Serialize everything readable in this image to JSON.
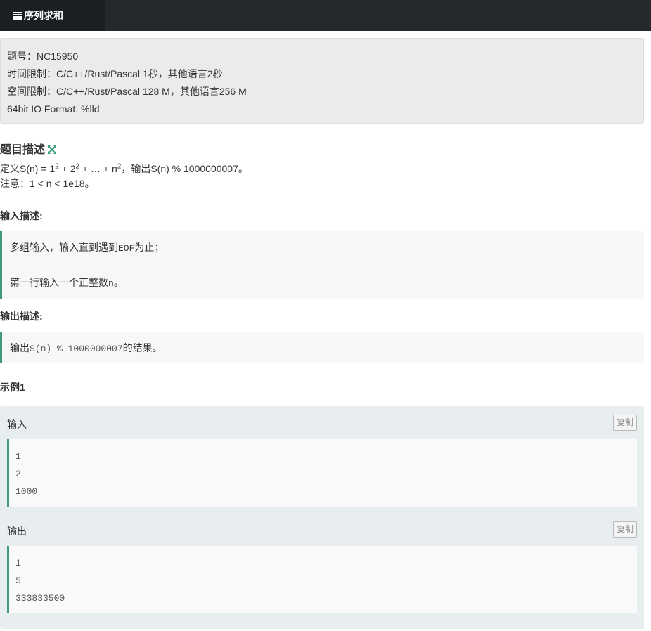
{
  "header": {
    "title": "序列求和",
    "icon": "list-icon"
  },
  "meta": {
    "problem_id": "题号：NC15950",
    "time_limit": "时间限制：C/C++/Rust/Pascal 1秒，其他语言2秒",
    "memory_limit": "空间限制：C/C++/Rust/Pascal 128 M，其他语言256 M",
    "io_format": "64bit IO Format: %lld"
  },
  "description": {
    "title": "题目描述",
    "expand_icon": "expand-icon",
    "def_prefix": "定义S(n) = 1",
    "exp": "2",
    "plus1": " + 2",
    "plus2": " + … + n",
    "def_suffix": "，输出S(n) % 1000000007。",
    "note": "注意：1 < n < 1e18。"
  },
  "input_desc": {
    "title": "输入描述:",
    "line1_text": "多组输入，输入直到遇到",
    "line1_code": "EOF",
    "line1_end": "为止；",
    "line2_text": "第一行输入一个正整数",
    "line2_code": "n",
    "line2_end": "。"
  },
  "output_desc": {
    "title": "输出描述:",
    "prefix": "输出",
    "code": "S(n) % 1000000007",
    "suffix": "的结果。"
  },
  "sample": {
    "title": "示例1",
    "input_label": "输入",
    "output_label": "输出",
    "copy_label": "复制",
    "input_lines": [
      "1",
      "2",
      "1000"
    ],
    "output_lines": [
      "1",
      "5",
      "333833500"
    ]
  },
  "colors": {
    "accent": "#3c9b7b",
    "topbar": "#24292e",
    "meta_bg": "#ebebeb",
    "sample_bg": "#e8edf0"
  }
}
